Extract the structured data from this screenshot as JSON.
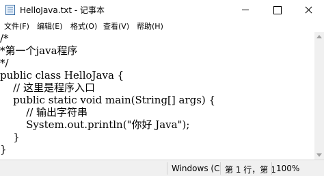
{
  "window": {
    "title": "HelloJava.txt - 记事本"
  },
  "menu": [
    "文件(F)",
    "编辑(E)",
    "格式(O)",
    "查看(V)",
    "帮助(H)"
  ],
  "editor": {
    "lines": [
      "/*",
      "*第一个java程序",
      "*/",
      "public class HelloJava {",
      "    // 这里是程序入口",
      "    public static void main(String[] args) {",
      "        // 输出字符串",
      "        System.out.println(\"你好 Java\");",
      "    }",
      "}"
    ]
  },
  "status": {
    "encoding": "Windows (C",
    "position": "第 1 行，第 1",
    "zoom": "100%"
  }
}
